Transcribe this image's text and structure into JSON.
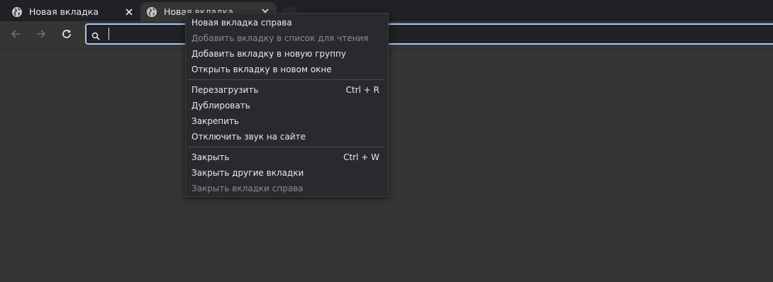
{
  "tabs": [
    {
      "title": "Новая вкладка",
      "active": false
    },
    {
      "title": "Новая вкладка",
      "active": true
    }
  ],
  "toolbar": {
    "back_icon": "arrow-left-icon",
    "forward_icon": "arrow-right-icon",
    "reload_icon": "reload-icon",
    "omnibox_value": ""
  },
  "context_menu": {
    "group1": [
      {
        "label": "Новая вкладка справа",
        "disabled": false
      },
      {
        "label": "Добавить вкладку в список для чтения",
        "disabled": true
      },
      {
        "label": "Добавить вкладку в новую группу",
        "disabled": false
      },
      {
        "label": "Открыть вкладку в новом окне",
        "disabled": false
      }
    ],
    "group2": [
      {
        "label": "Перезагрузить",
        "shortcut": "Ctrl + R",
        "disabled": false
      },
      {
        "label": "Дублировать",
        "disabled": false
      },
      {
        "label": "Закрепить",
        "disabled": false
      },
      {
        "label": "Отключить звук на сайте",
        "disabled": false
      }
    ],
    "group3": [
      {
        "label": "Закрыть",
        "shortcut": "Ctrl + W",
        "disabled": false
      },
      {
        "label": "Закрыть другие вкладки",
        "disabled": false
      },
      {
        "label": "Закрыть вкладки справа",
        "disabled": true
      }
    ]
  },
  "colors": {
    "focus_ring": "#a8c7fa",
    "menu_bg": "#292a2d",
    "page_bg": "#353535"
  }
}
